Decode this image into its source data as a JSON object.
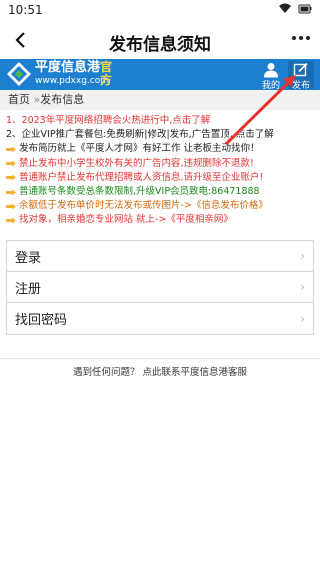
{
  "status": {
    "time": "10:51"
  },
  "nav": {
    "title": "发布信息须知"
  },
  "banner": {
    "logo_text": "平度信息港",
    "logo_official": "官方",
    "logo_url": "www.pdxxg.com",
    "mine_label": "我的",
    "publish_label": "发布",
    "accent": "#1d7fd0"
  },
  "breadcrumb": {
    "home": "首页",
    "sep": "»",
    "current": "发布信息"
  },
  "notices": [
    {
      "text": "1、2023年平度网络招聘会火热进行中,点击了解",
      "color": "red",
      "hand": false
    },
    {
      "text": "2、企业VIP推广套餐包:免费刷新|修改|发布,广告置顶, 点击了解",
      "color": "black",
      "hand": false
    },
    {
      "text": "发布简历就上《平度人才网》有好工作 让老板主动找你！",
      "color": "black",
      "hand": true
    },
    {
      "text": "禁止发布中小学生校外有关的广告内容,违规删除不退款!",
      "color": "red",
      "hand": true
    },
    {
      "text": "普通账户禁止发布代理招聘或人资信息,请升级至企业账户!",
      "color": "red",
      "hand": true
    },
    {
      "text": "普通账号条数受总条数限制,升级VIP会员致电:86471888",
      "color": "green",
      "hand": true
    },
    {
      "text": "余额低于发布单价时无法发布或传图片->《信息发布价格》",
      "color": "orange",
      "hand": true
    },
    {
      "text": "找对象，相亲婚恋专业网站 就上->《平度相亲网》",
      "color": "red",
      "hand": true
    }
  ],
  "menu": [
    {
      "label": "登录"
    },
    {
      "label": "注册"
    },
    {
      "label": "找回密码"
    }
  ],
  "footer": {
    "text": "遇到任何问题？ 点此联系平度信息港客服"
  }
}
